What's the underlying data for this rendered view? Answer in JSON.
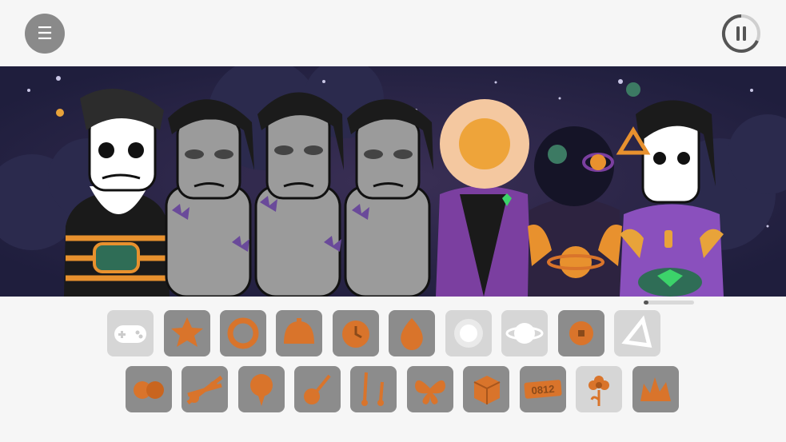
{
  "header": {
    "menu_icon": "hamburger-menu-icon",
    "menu_glyph": "☰",
    "pause_icon": "pause-icon"
  },
  "colors": {
    "background": "#f6f6f6",
    "stage_background": "#1f1e3d",
    "tile_active": "#8c8c8c",
    "tile_inactive": "#d6d6d6",
    "sound_orange": "#d9742b"
  },
  "stage": {
    "characters": [
      {
        "name": "character-gamer",
        "icon": "gamepad"
      },
      {
        "name": "character-grey-1",
        "icon": "none"
      },
      {
        "name": "character-grey-2",
        "icon": "none"
      },
      {
        "name": "character-grey-3",
        "icon": "none"
      },
      {
        "name": "character-sun",
        "icon": "sun"
      },
      {
        "name": "character-cosmic",
        "icon": "planet"
      },
      {
        "name": "character-triangle",
        "icon": "triangle"
      }
    ]
  },
  "sound_tiles_row1": [
    {
      "icon": "gamepad-icon",
      "state": "inactive"
    },
    {
      "icon": "star-icon",
      "state": "active"
    },
    {
      "icon": "ring-icon",
      "state": "active"
    },
    {
      "icon": "bell-icon",
      "state": "active"
    },
    {
      "icon": "clock-icon",
      "state": "active"
    },
    {
      "icon": "drop-icon",
      "state": "active"
    },
    {
      "icon": "sun-icon",
      "state": "inactive"
    },
    {
      "icon": "planet-icon",
      "state": "inactive"
    },
    {
      "icon": "square-button-icon",
      "state": "active"
    },
    {
      "icon": "triangle-icon",
      "state": "inactive"
    }
  ],
  "sound_tiles_row2": [
    {
      "icon": "beans-icon",
      "state": "active"
    },
    {
      "icon": "violins-icon",
      "state": "active"
    },
    {
      "icon": "pin-icon",
      "state": "active"
    },
    {
      "icon": "guitar-icon",
      "state": "active"
    },
    {
      "icon": "drumsticks-icon",
      "state": "active"
    },
    {
      "icon": "butterfly-icon",
      "state": "active"
    },
    {
      "icon": "cube-icon",
      "state": "active"
    },
    {
      "icon": "tag-icon",
      "state": "active",
      "text": "0812"
    },
    {
      "icon": "flower-icon",
      "state": "inactive"
    },
    {
      "icon": "fire-icon",
      "state": "active"
    }
  ]
}
